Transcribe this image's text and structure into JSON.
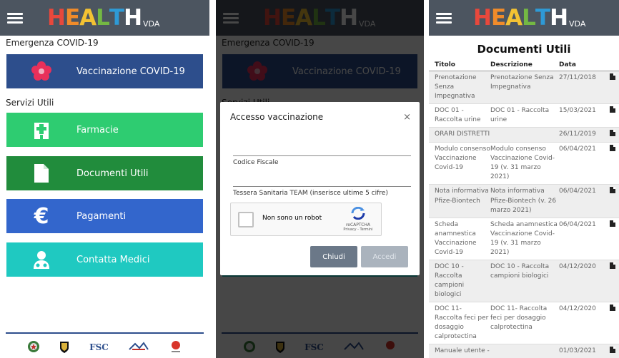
{
  "app": {
    "logo_text": "HEALTH",
    "logo_suffix": "VDA"
  },
  "home": {
    "section_covid": "Emergenza COVID-19",
    "section_servizi": "Servizi Utili",
    "tiles": [
      {
        "label": "Vaccinazione COVID-19",
        "icon": "flower-icon",
        "color": "#2d4e8c"
      },
      {
        "label": "Farmacie",
        "icon": "pharmacy-icon",
        "color": "#2ecc71"
      },
      {
        "label": "Documenti Utili",
        "icon": "document-icon",
        "color": "#218c3c"
      },
      {
        "label": "Pagamenti",
        "icon": "euro-icon",
        "color": "#3366cc"
      },
      {
        "label": "Contatta Medici",
        "icon": "doctor-icon",
        "color": "#1fc9c1"
      }
    ],
    "footer_logos": [
      "Repubblica Italiana",
      "Regione Valle d'Aosta",
      "FSC",
      "Azienda USL",
      "INMI"
    ],
    "footer_fsc": "FSC"
  },
  "dialog": {
    "title": "Accesso vaccinazione",
    "close": "×",
    "codice_fiscale_label": "Codice Fiscale",
    "tessera_label": "Tessera Sanitaria TEAM (inserisce ultime 5 cifre)",
    "captcha_text": "Non sono un robot",
    "captcha_brand": "reCAPTCHA",
    "captcha_links": "Privacy - Termini",
    "btn_close": "Chiudi",
    "btn_login": "Accedi"
  },
  "documents": {
    "title": "Documenti Utili",
    "columns": [
      "Titolo",
      "Descrizione",
      "Data"
    ],
    "rows": [
      {
        "titolo": "Prenotazione Senza Impegnativa",
        "descrizione": "Prenotazione Senza Impegnativa",
        "data": "27/11/2018"
      },
      {
        "titolo": "DOC 01 - Raccolta urine",
        "descrizione": "DOC 01 - Raccolta urine",
        "data": "15/03/2021"
      },
      {
        "titolo": "ORARI DISTRETTI",
        "descrizione": "",
        "data": "26/11/2019"
      },
      {
        "titolo": "Modulo consenso Vaccinazione Covid-19",
        "descrizione": "Modulo consenso Vaccinazione Covid-19 (v. 31 marzo 2021)",
        "data": "06/04/2021"
      },
      {
        "titolo": "Nota informativa Pfize-Biontech",
        "descrizione": "Nota informativa Pfize-Biontech (v. 26 marzo 2021)",
        "data": "06/04/2021"
      },
      {
        "titolo": "Scheda anamnestica Vaccinazione Covid-19",
        "descrizione": "Scheda anamnestica Vaccinazione Covid-19 (v. 31 marzo 2021)",
        "data": "06/04/2021"
      },
      {
        "titolo": "DOC 10 - Raccolta campioni biologici",
        "descrizione": "DOC 10 - Raccolta campioni biologici",
        "data": "04/12/2020"
      },
      {
        "titolo": "DOC 11- Raccolta feci per dosaggio calprotectina",
        "descrizione": "DOC 11- Raccolta feci per dosaggio calprotectina",
        "data": "04/12/2020"
      },
      {
        "titolo": "Manuale utente -",
        "descrizione": "",
        "data": "01/03/2021"
      }
    ]
  }
}
